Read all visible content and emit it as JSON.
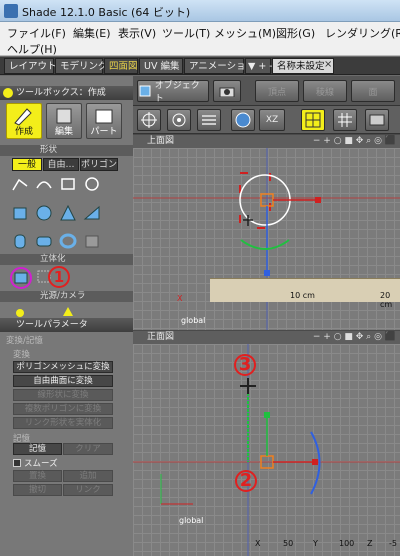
{
  "window": {
    "title": "Shade 12.1.0 Basic (64 ビット)"
  },
  "menu": {
    "items": [
      "ファイル(F)",
      "編集(E)",
      "表示(V)",
      "ツール(T)",
      "メッシュ(M)",
      "図形(G)",
      "レンダリング(R)",
      "ヘルプ(H)"
    ]
  },
  "tabs": {
    "layout": "レイアウト",
    "modeling": "モデリング",
    "four_view": "四面図",
    "uv_edit": "UV 編集",
    "animation": "アニメーション",
    "more": "▼ + -",
    "document": "名称未設定",
    "close": "×"
  },
  "toolbox": {
    "title": "ツールボックス：作成",
    "modes": [
      "作成",
      "編集",
      "パート"
    ],
    "shape_section": "形状",
    "segments": [
      "一般",
      "自由…",
      "ポリゴン"
    ],
    "solid_section": "立体化",
    "light_section": "光源/カメラ"
  },
  "params": {
    "title": "ツールパラメータ",
    "group_label": "変換/記憶",
    "sub_label": "変換",
    "buttons": [
      {
        "label": "ポリゴンメッシュに変換",
        "enabled": true
      },
      {
        "label": "自由曲面に変換",
        "enabled": true
      },
      {
        "label": "線形状に変換",
        "enabled": false
      },
      {
        "label": "複数ポリゴンに変換",
        "enabled": false
      },
      {
        "label": "リンク形状を実体化",
        "enabled": false
      }
    ],
    "memory_label": "記憶",
    "memory_btn": "記憶",
    "clear_btn": "クリア",
    "smooth_label": "スムーズ",
    "replace_btn": "置換",
    "add_btn": "追加",
    "undo_btn": "撤切",
    "link_btn": "リンク"
  },
  "toolbar": {
    "object_label": "オブジェクト",
    "vertex_label": "頂点",
    "edge_label": "稜線",
    "face_label": "面",
    "xz_label": "XZ"
  },
  "top_view": {
    "title": "上面図",
    "ruler_10": "10 cm",
    "ruler_20": "20 cm",
    "axis_x": "X",
    "global_label": "global"
  },
  "front_view": {
    "title": "正面図",
    "axis_y": "Y",
    "global_label": "global",
    "scale_labels": [
      "X",
      "50",
      "Y",
      "100",
      "Z",
      "-5"
    ]
  },
  "annotations": {
    "a1": "1",
    "a2": "2",
    "a3": "3"
  },
  "colors": {
    "accent_yellow": "#f3ee1a",
    "annotation_red": "#e02020",
    "magenta": "#d020d0"
  }
}
